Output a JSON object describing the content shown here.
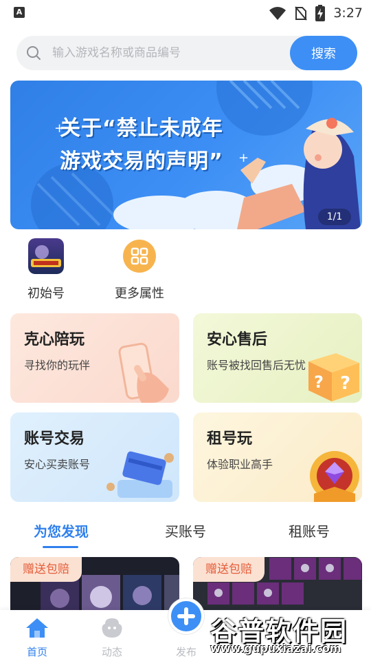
{
  "status_bar": {
    "time": "3:27",
    "app_icon": "A"
  },
  "search": {
    "placeholder": "输入游戏名称或商品编号",
    "button_label": "搜索"
  },
  "banner": {
    "title_line1": "关于“禁止未成年",
    "title_line2": "游戏交易的声明”",
    "page_indicator": "1/1"
  },
  "quick_entries": [
    {
      "label": "初始号",
      "icon": "game-logo-icon"
    },
    {
      "label": "更多属性",
      "icon": "grid-icon"
    }
  ],
  "cards": [
    {
      "title": "克心陪玩",
      "subtitle": "寻找你的玩伴",
      "icon": "phone-hand-icon",
      "color": "#fde4dc"
    },
    {
      "title": "安心售后",
      "subtitle": "账号被找回售后无忧",
      "icon": "question-box-icon",
      "color": "#eef5cf"
    },
    {
      "title": "账号交易",
      "subtitle": "安心买卖账号",
      "icon": "card-coin-icon",
      "color": "#d9ecfb"
    },
    {
      "title": "租号玩",
      "subtitle": "体验职业高手",
      "icon": "trophy-gem-icon",
      "color": "#fdf1d6"
    }
  ],
  "tabs": [
    {
      "label": "为您发现",
      "active": true
    },
    {
      "label": "买账号",
      "active": false
    },
    {
      "label": "租账号",
      "active": false
    }
  ],
  "products": [
    {
      "badge": "赠送包赔"
    },
    {
      "badge": "赠送包赔"
    }
  ],
  "bottom_nav": [
    {
      "label": "首页",
      "icon": "home-icon",
      "active": true
    },
    {
      "label": "动态",
      "icon": "moments-icon",
      "active": false
    },
    {
      "label": "发布",
      "icon": "plus-icon",
      "active": false
    }
  ],
  "watermark": {
    "title": "谷普软件园",
    "url": "www.gupuxiazai.com"
  },
  "colors": {
    "accent": "#3d8ff5",
    "badge_text": "#e55d3a"
  }
}
